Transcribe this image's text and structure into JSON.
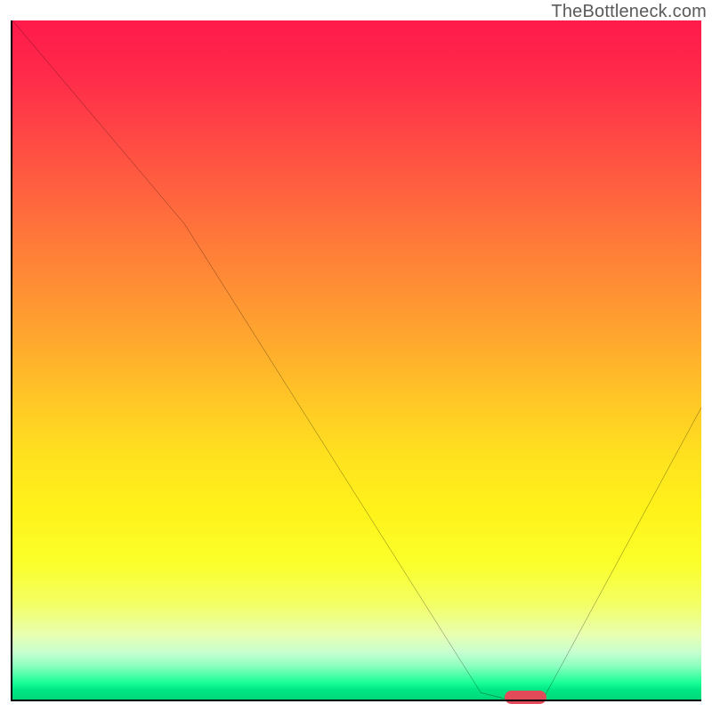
{
  "watermark": "TheBottleneck.com",
  "colors": {
    "gradient_top": "#ff1a4b",
    "gradient_bottom": "#00d878",
    "line": "#000000",
    "axis": "#000000",
    "marker": "#e24a5a"
  },
  "chart_data": {
    "type": "line",
    "title": "",
    "xlabel": "",
    "ylabel": "",
    "xlim": [
      0,
      100
    ],
    "ylim": [
      0,
      100
    ],
    "x": [
      0,
      25,
      68,
      72,
      77,
      100
    ],
    "values": [
      100,
      70,
      1,
      0,
      0,
      43
    ],
    "marker": {
      "x_start": 72,
      "x_end": 77,
      "y": 0
    },
    "annotations": []
  }
}
